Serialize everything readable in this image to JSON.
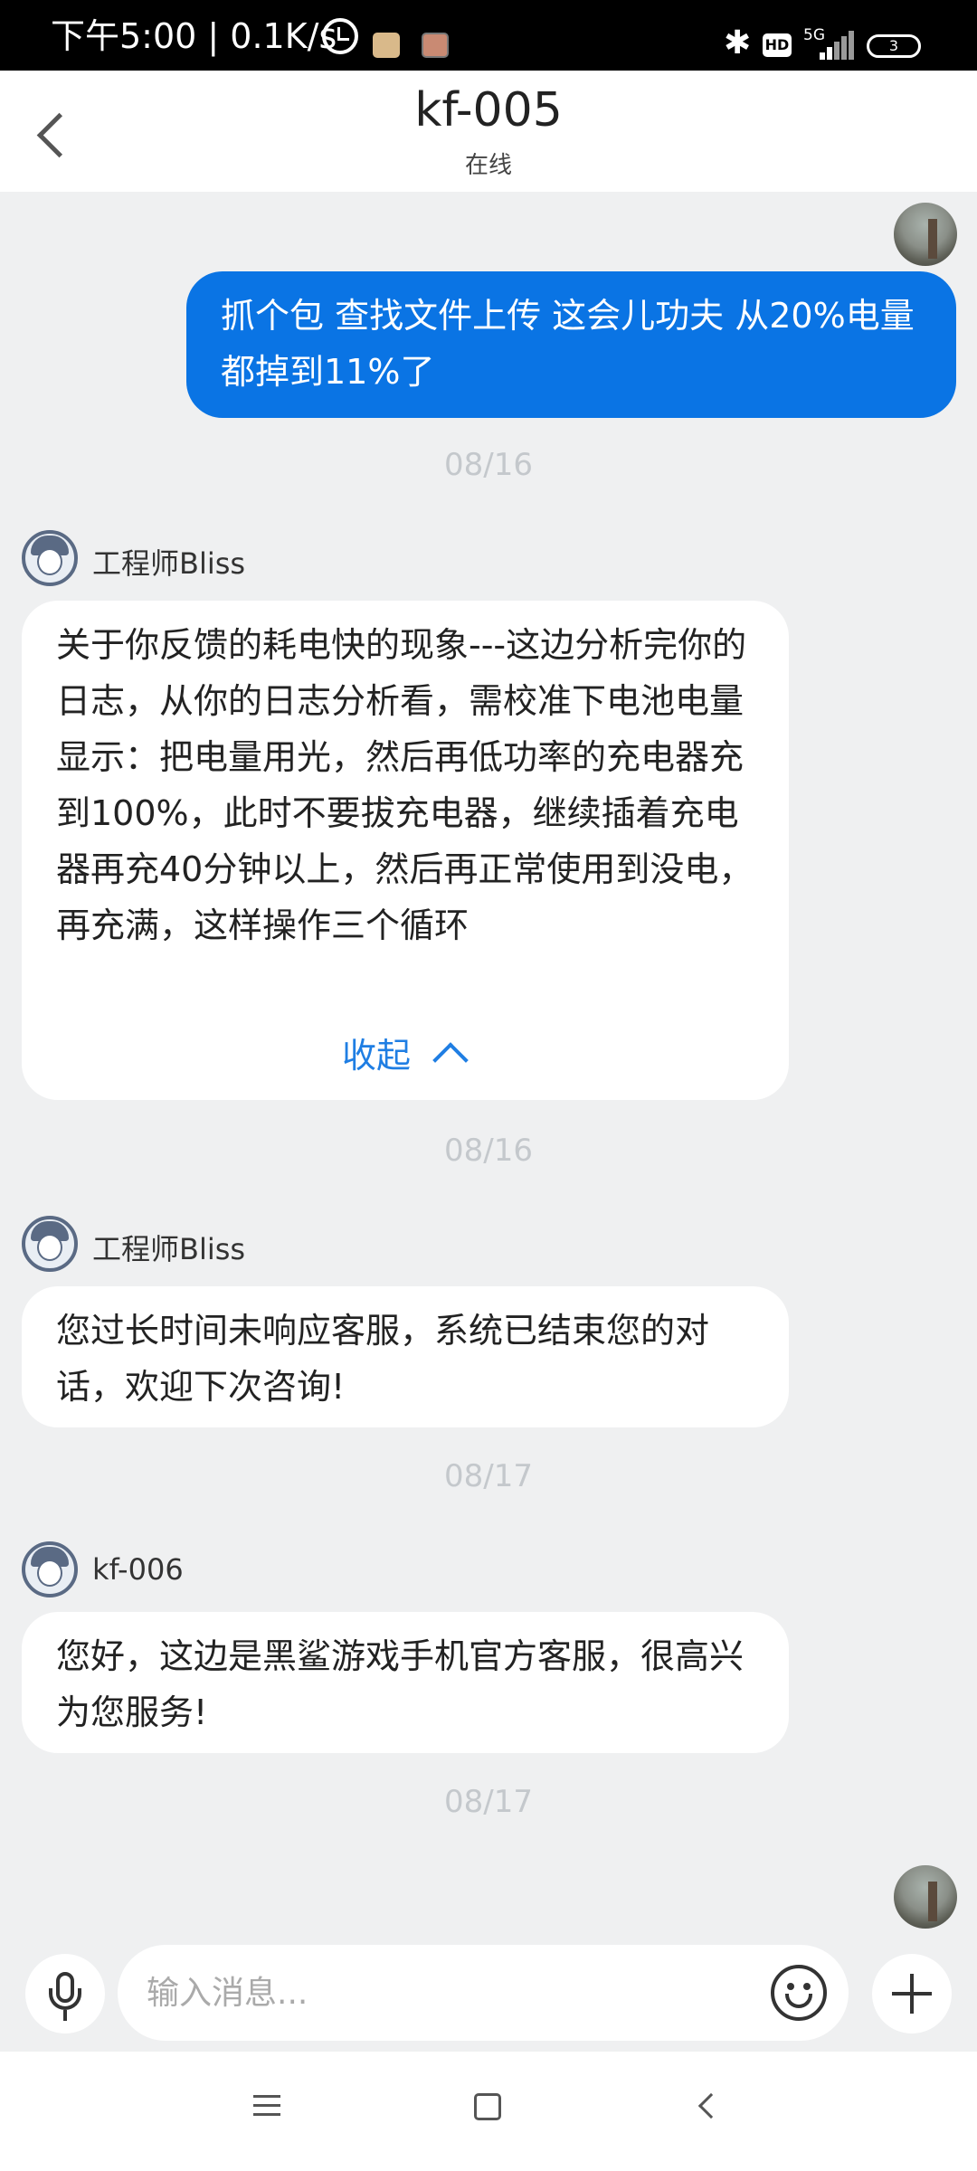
{
  "status_bar": {
    "time": "下午5:00 | 0.1K/s",
    "bluetooth_icon": "bluetooth-icon",
    "hd_label": "HD",
    "network": "5G",
    "battery": "3"
  },
  "header": {
    "title": "kf-005",
    "subtitle": "在线"
  },
  "messages": [
    {
      "type": "outgoing",
      "text": "抓个包  查找文件上传 这会儿功夫 从20%电量都掉到11%了"
    },
    {
      "type": "date",
      "text": "08/16"
    },
    {
      "type": "incoming",
      "sender": "工程师Bliss",
      "text": "关于你反馈的耗电快的现象---这边分析完你的日志，从你的日志分析看，需校准下电池电量显示：把电量用光，然后再低功率的充电器充到100%，此时不要拔充电器，继续插着充电器再充40分钟以上，然后再正常使用到没电，再充满，这样操作三个循环",
      "collapse_label": "收起"
    },
    {
      "type": "date",
      "text": "08/16"
    },
    {
      "type": "incoming",
      "sender": "工程师Bliss",
      "text": "您过长时间未响应客服，系统已结束您的对话，欢迎下次咨询!"
    },
    {
      "type": "date",
      "text": "08/17"
    },
    {
      "type": "incoming",
      "sender": "kf-006",
      "text": "您好，这边是黑鲨游戏手机官方客服，很高兴为您服务!"
    },
    {
      "type": "date",
      "text": "08/17"
    }
  ],
  "input": {
    "placeholder": "输入消息..."
  },
  "colors": {
    "accent": "#0a74e4",
    "link": "#1f7ee3",
    "background": "#eff0f1"
  }
}
